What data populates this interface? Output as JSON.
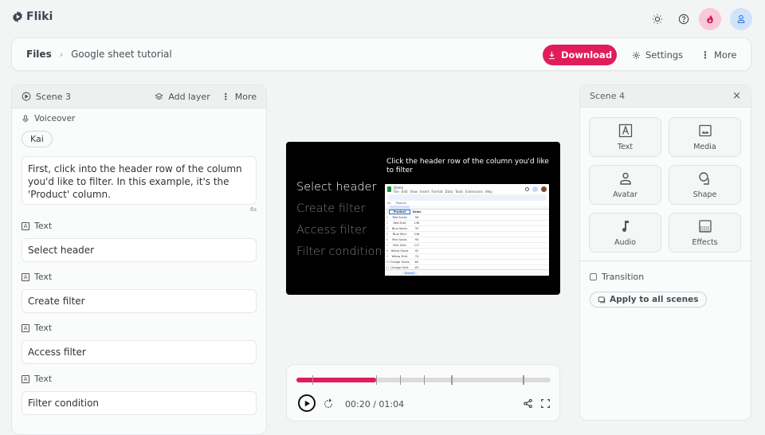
{
  "app": {
    "name": "Fliki"
  },
  "topbar": {
    "icons": [
      "sun-icon",
      "help-icon",
      "fire-icon",
      "user-icon"
    ]
  },
  "header": {
    "breadcrumb_root": "Files",
    "breadcrumb_sep": "›",
    "project_title": "Google sheet tutorial",
    "download_label": "Download",
    "settings_label": "Settings",
    "more_label": "More"
  },
  "left_panel": {
    "scene_label": "Scene 3",
    "add_layer_label": "Add layer",
    "more_label": "More",
    "voiceover_label": "Voiceover",
    "voice_name": "Kai",
    "voiceover_text": "First, click into the header row of the column you'd like to filter. In this example, it's the 'Product' column.",
    "duration": "6s",
    "text_layers": [
      {
        "label": "Text",
        "value": "Select header"
      },
      {
        "label": "Text",
        "value": "Create filter"
      },
      {
        "label": "Text",
        "value": "Access filter"
      },
      {
        "label": "Text",
        "value": "Filter condition"
      }
    ]
  },
  "preview": {
    "caption": "Click the header row of the column you'd like to filter",
    "steps": [
      "Select header",
      "Create filter",
      "Access filter",
      "Filter condition"
    ],
    "active_step": 0,
    "sheet": {
      "doc_name": "Demo",
      "menu": [
        "File",
        "Edit",
        "View",
        "Insert",
        "Format",
        "Data",
        "Tools",
        "Extensions",
        "Help"
      ],
      "cell_ref": "A1",
      "formula": "Product",
      "headers": [
        "Product",
        "Sales"
      ],
      "rows": [
        [
          "Red Socks",
          "58"
        ],
        [
          "Red Shirt",
          "136"
        ],
        [
          "Blue Socks",
          "33"
        ],
        [
          "Blue Shirt",
          "218"
        ],
        [
          "Pink Socks",
          "95"
        ],
        [
          "Pink Shirt",
          "117"
        ],
        [
          "Yellow Socks",
          "92"
        ],
        [
          "Yellow Shirt",
          "74"
        ],
        [
          "Orange Socks",
          "84"
        ],
        [
          "Orange Shirt",
          "63"
        ]
      ],
      "tab_name": "Sheet1"
    }
  },
  "player": {
    "current_time": "00:20",
    "total_time": "01:04",
    "time_sep": " / ",
    "progress_fraction": 0.3125,
    "scene_markers_seconds": [
      4,
      20,
      26,
      32,
      39,
      57
    ]
  },
  "right_panel": {
    "scene_label": "Scene 4",
    "tiles": [
      {
        "label": "Text",
        "icon": "text-icon"
      },
      {
        "label": "Media",
        "icon": "image-icon"
      },
      {
        "label": "Avatar",
        "icon": "avatar-icon"
      },
      {
        "label": "Shape",
        "icon": "shape-icon"
      },
      {
        "label": "Audio",
        "icon": "music-icon"
      },
      {
        "label": "Effects",
        "icon": "effects-icon"
      }
    ],
    "transition_label": "Transition",
    "transition_checked": false,
    "apply_all_label": "Apply to all scenes"
  },
  "colors": {
    "accent": "#e01c5c",
    "fire_bg": "#f9c9d9",
    "user_bg": "#cfe3fb",
    "user_fg": "#2a77d6"
  }
}
